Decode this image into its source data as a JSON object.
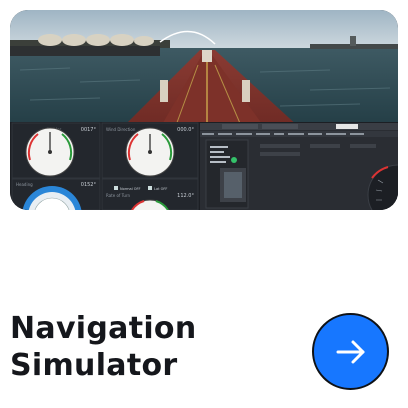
{
  "card": {
    "title_line1": "Navigation",
    "title_line2": "Simulator",
    "accent_color": "#1777ff",
    "action_icon": "arrow-right-icon"
  },
  "screenshot": {
    "panel_values": [
      "0017°",
      "000.0°",
      "0152°",
      "112.0°"
    ],
    "panel_labels": [
      "Rudder",
      "Wind Direction",
      "Heading",
      "Rate of Turn"
    ],
    "options": [
      "Normal OFF",
      "Lat OFF"
    ]
  }
}
